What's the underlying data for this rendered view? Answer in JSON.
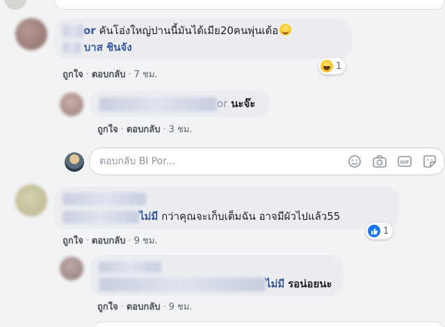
{
  "comments": [
    {
      "author_visible": "or",
      "text": "คันโอ่งใหญ่ปานนี้มันได้เมีย20คนพุ่นเด้อ",
      "tagged_name": "บาส ชินจัง",
      "actions": {
        "like": "ถูกใจ",
        "reply": "ตอบกลับ",
        "time": "7 ชม."
      },
      "reaction": {
        "icon": "haha-emoji-icon",
        "count": "1"
      },
      "replies": [
        {
          "author_visible": "or",
          "text": "นะจ๊ะ",
          "actions": {
            "like": "ถูกใจ",
            "reply": "ตอบกลับ",
            "time": "3 ชม."
          }
        }
      ],
      "reply_input": {
        "placeholder": "ตอบกลับ Bl Por..."
      }
    },
    {
      "author_visible": "",
      "text_visible_prefix": "ไม่มี",
      "text": "กว่าคุณจะเก็บเต็มฉัน อาจมีผัวไปแล้ว55",
      "actions": {
        "like": "ถูกใจ",
        "reply": "ตอบกลับ",
        "time": "9 ชม."
      },
      "reaction": {
        "icon": "like-icon",
        "count": "1"
      },
      "replies": [
        {
          "text_visible_prefix": "ไม่มี",
          "text": "รอน่อยนะ",
          "actions": {
            "like": "ถูกใจ",
            "reply": "ตอบกลับ",
            "time": "9 ชม."
          }
        }
      ]
    }
  ],
  "reply_input_icons": [
    "emoji-icon",
    "camera-icon",
    "gif-icon",
    "sticker-icon"
  ],
  "colors": {
    "background": "#f2f3f5",
    "bubble": "#ebedf0",
    "link": "#385898",
    "meta": "#606770",
    "like_blue": "#1877f2"
  }
}
